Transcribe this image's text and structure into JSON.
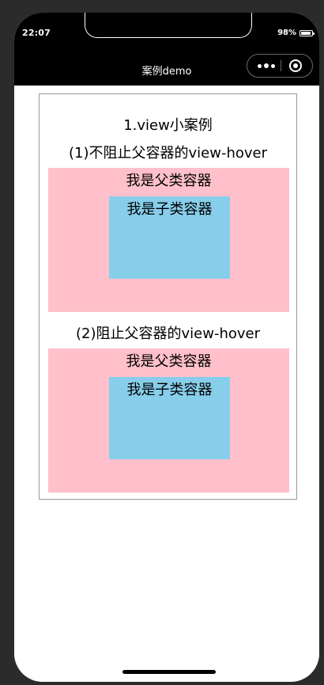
{
  "status_bar": {
    "time": "22:07",
    "battery_text": "98%",
    "battery_level": 0.98
  },
  "nav": {
    "title": "案例demo"
  },
  "page": {
    "title": "1.view小案例",
    "section1": {
      "title": "(1)不阻止父容器的view-hover",
      "parent_label": "我是父类容器",
      "child_label": "我是子类容器"
    },
    "section2": {
      "title": "(2)阻止父容器的view-hover",
      "parent_label": "我是父类容器",
      "child_label": "我是子类容器"
    }
  },
  "colors": {
    "parent_bg": "#ffc0cb",
    "child_bg": "#87ceeb",
    "bar_bg": "#000000"
  },
  "icons": {
    "more": "more-dots-icon",
    "close": "close-mini-program-icon"
  }
}
